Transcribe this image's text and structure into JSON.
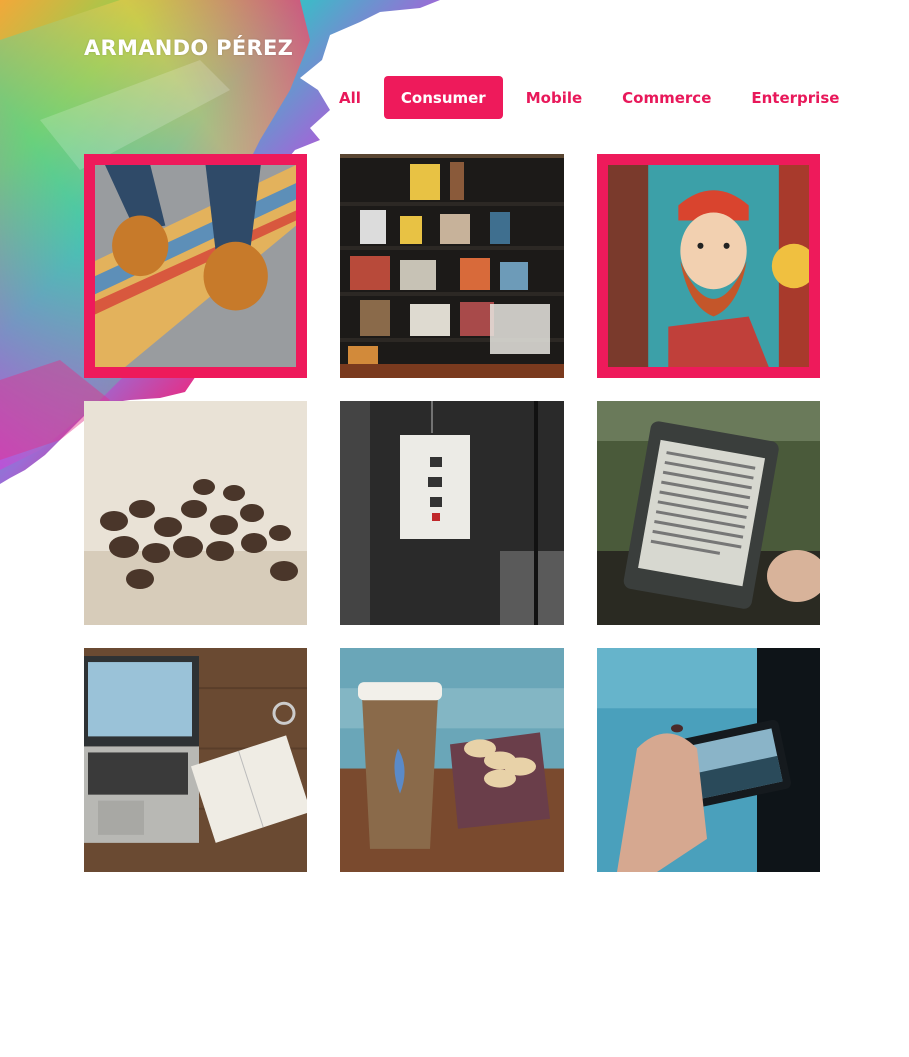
{
  "site": {
    "title": "ARMANDO PÉREZ"
  },
  "colors": {
    "accent": "#ee1a5b",
    "background": "#ffffff"
  },
  "filters": [
    {
      "label": "All",
      "active": false
    },
    {
      "label": "Consumer",
      "active": true
    },
    {
      "label": "Mobile",
      "active": false
    },
    {
      "label": "Commerce",
      "active": false
    },
    {
      "label": "Enterprise",
      "active": false
    }
  ],
  "portfolio": [
    {
      "subject": "skateboard-shoes-photo",
      "selected": true
    },
    {
      "subject": "bookshelf-photo",
      "selected": false
    },
    {
      "subject": "bearded-man-mural-photo",
      "selected": true
    },
    {
      "subject": "coffee-beans-photo",
      "selected": false
    },
    {
      "subject": "paper-lantern-photo",
      "selected": false
    },
    {
      "subject": "ereader-photo",
      "selected": false
    },
    {
      "subject": "laptop-notebook-photo",
      "selected": false
    },
    {
      "subject": "coffee-cup-macarons-photo",
      "selected": false
    },
    {
      "subject": "phone-camera-photo",
      "selected": false
    }
  ]
}
